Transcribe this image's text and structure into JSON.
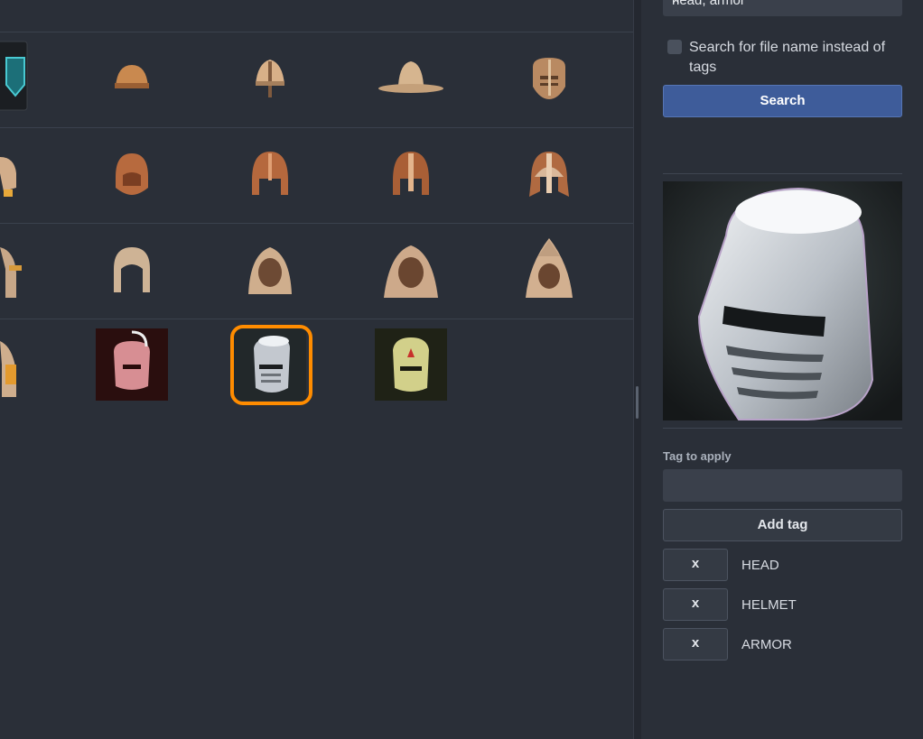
{
  "search": {
    "value": "head, armor",
    "clear_label": "×"
  },
  "filename_toggle": {
    "label": "Search for file name instead of tags",
    "checked": false
  },
  "search_button": {
    "label": "Search"
  },
  "tag_section": {
    "label": "Tag to apply",
    "input_value": "",
    "add_label": "Add tag"
  },
  "tags": [
    {
      "remove_label": "x",
      "name": "HEAD"
    },
    {
      "remove_label": "x",
      "name": "HELMET"
    },
    {
      "remove_label": "x",
      "name": "ARMOR"
    }
  ],
  "grid": {
    "rows": [
      [
        "blue-shield-icon",
        "leather-cap-icon",
        "nasal-helm-icon",
        "wide-brim-hat-icon",
        "visored-helm-icon"
      ],
      [
        "leather-helm-partial-icon",
        "leather-coif-icon",
        "copper-helmet-icon",
        "copper-nasal-helmet-icon",
        "viking-helmet-icon"
      ],
      [
        "chain-coif-partial-icon",
        "chain-hood-icon",
        "chain-coif-icon",
        "chain-hood-large-icon",
        "pointed-chain-coif-icon"
      ],
      [
        "chain-hood-partial-icon",
        "red-great-helm-icon",
        "steel-great-helm-icon",
        "gold-great-helm-icon"
      ]
    ],
    "selected": "steel-great-helm-icon"
  },
  "colors": {
    "accent": "#ff8c00",
    "primary_button": "#3e5c9a",
    "background": "#2a2f38"
  }
}
